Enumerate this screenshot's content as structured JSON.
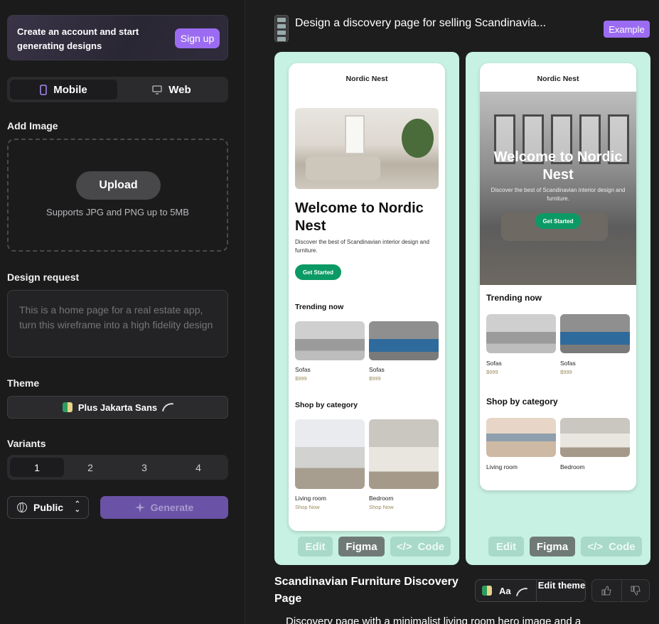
{
  "signup": {
    "text": "Create an account and start generating designs",
    "button": "Sign up"
  },
  "platform": {
    "options": [
      "Mobile",
      "Web"
    ],
    "selected": "Mobile"
  },
  "add_image": {
    "label": "Add Image",
    "button": "Upload",
    "note": "Supports JPG and PNG up to 5MB"
  },
  "design_request": {
    "label": "Design request",
    "placeholder": "This is a home page for a real estate app, turn this wireframe into a high fidelity design"
  },
  "theme": {
    "label": "Theme",
    "font": "Plus Jakarta Sans"
  },
  "variants": {
    "label": "Variants",
    "options": [
      "1",
      "2",
      "3",
      "4"
    ],
    "selected": "1"
  },
  "visibility": {
    "value": "Public"
  },
  "generate": {
    "label": "Generate"
  },
  "result": {
    "request_title": "Design a discovery page for selling Scandinavia...",
    "badge": "Example",
    "title": "Scandinavian Furniture Discovery Page",
    "description": "Discovery page with a minimalist living room hero image and a",
    "theme_aa": "Aa",
    "edit_theme": "Edit theme"
  },
  "mobile_design": {
    "brand": "Nordic Nest",
    "hero_title": "Welcome to Nordic Nest",
    "hero_text": "Discover the best of Scandinavian interior design and furniture.",
    "cta": "Get Started",
    "trending_title": "Trending now",
    "trending": [
      {
        "name": "Sofas",
        "price": "$999"
      },
      {
        "name": "Sofas",
        "price": "$999"
      }
    ],
    "category_title": "Shop by category",
    "categories": [
      {
        "name": "Living room",
        "link": "Shop Now"
      },
      {
        "name": "Bedroom",
        "link": "Shop Now"
      }
    ]
  },
  "actions": {
    "edit": "Edit",
    "figma": "Figma",
    "code": "Code"
  },
  "colors": {
    "accent": "#9b6cf2",
    "card_bg": "#c7f1e2",
    "cta_green": "#0b9a66"
  }
}
